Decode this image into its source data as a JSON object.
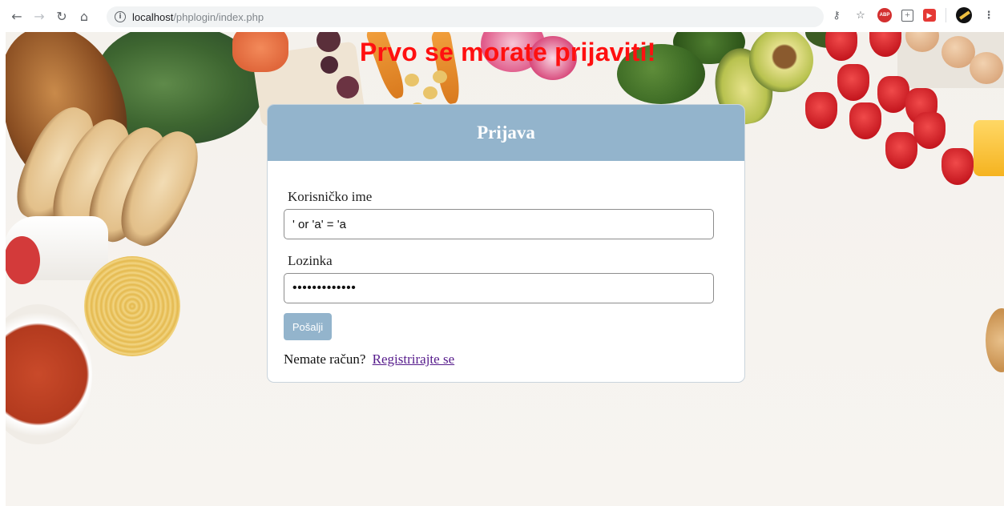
{
  "browser": {
    "url_host": "localhost",
    "url_path": "/phplogin/index.php",
    "icons": [
      "back-icon",
      "forward-icon",
      "reload-icon",
      "home-icon",
      "info-icon",
      "key-icon",
      "star-icon",
      "adblock-icon",
      "extension-plus-icon",
      "extension-red-icon",
      "profile-icon",
      "menu-icon"
    ],
    "abp_label": "ABP"
  },
  "page": {
    "alert": "Prvo se morate prijaviti!"
  },
  "login": {
    "title": "Prijava",
    "username_label": "Korisničko ime",
    "username_value": "' or 'a' = 'a",
    "password_label": "Lozinka",
    "password_value": "•••••••••••••",
    "submit_label": "Pošalji",
    "footer_text": "Nemate račun?",
    "register_link": "Registrirajte se"
  },
  "colors": {
    "alert": "#ff1010",
    "header_bg": "#93b4cc",
    "link": "#551a8b"
  }
}
